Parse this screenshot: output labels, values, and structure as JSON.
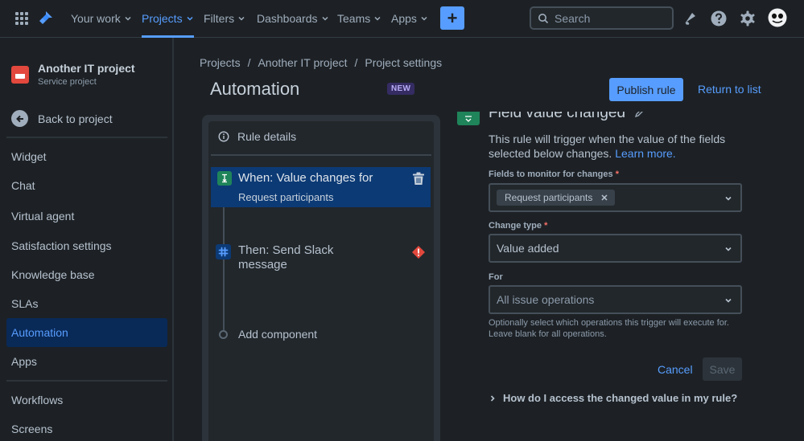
{
  "topnav": {
    "items": [
      {
        "label": "Your work"
      },
      {
        "label": "Projects",
        "active": true
      },
      {
        "label": "Filters"
      },
      {
        "label": "Dashboards"
      },
      {
        "label": "Teams"
      },
      {
        "label": "Apps"
      }
    ],
    "create_label": "+",
    "search_placeholder": "Search",
    "icons": [
      "notifications-icon",
      "help-icon",
      "settings-icon",
      "avatar"
    ]
  },
  "sidebar": {
    "project_name": "Another IT project",
    "project_type": "Service project",
    "back_label": "Back to project",
    "items": [
      {
        "label": "Widget"
      },
      {
        "label": "Chat"
      },
      {
        "label": "Virtual agent"
      },
      {
        "label": "Satisfaction settings"
      },
      {
        "label": "Knowledge base"
      },
      {
        "label": "SLAs"
      },
      {
        "label": "Automation",
        "selected": true
      },
      {
        "label": "Apps"
      }
    ],
    "items2": [
      {
        "label": "Workflows"
      },
      {
        "label": "Screens"
      }
    ]
  },
  "breadcrumb": [
    "Projects",
    "Another IT project",
    "Project settings"
  ],
  "page": {
    "title": "Automation",
    "badge": "NEW",
    "publish_label": "Publish rule",
    "return_label": "Return to list"
  },
  "rule": {
    "details_label": "Rule details",
    "when_title": "When: Value changes for",
    "when_sub": "Request participants",
    "then_title": "Then: Send Slack message",
    "add_component": "Add component"
  },
  "config": {
    "title": "Field value changed",
    "description": "This rule will trigger when the value of the fields selected below changes.",
    "learn_more": "Learn more.",
    "fields_label": "Fields to monitor for changes",
    "fields_tag": "Request participants",
    "change_type_label": "Change type",
    "change_type_value": "Value added",
    "for_label": "For",
    "for_value": "All issue operations",
    "hint": "Optionally select which operations this trigger will execute for. Leave blank for all operations.",
    "cancel_label": "Cancel",
    "save_label": "Save",
    "howto_label": "How do I access the changed value in my rule?"
  },
  "colors": {
    "accent": "#579dff",
    "background": "#1d2125",
    "selected_bg": "#092957",
    "trigger_green": "#1f845a",
    "error_red": "#e2483d"
  }
}
